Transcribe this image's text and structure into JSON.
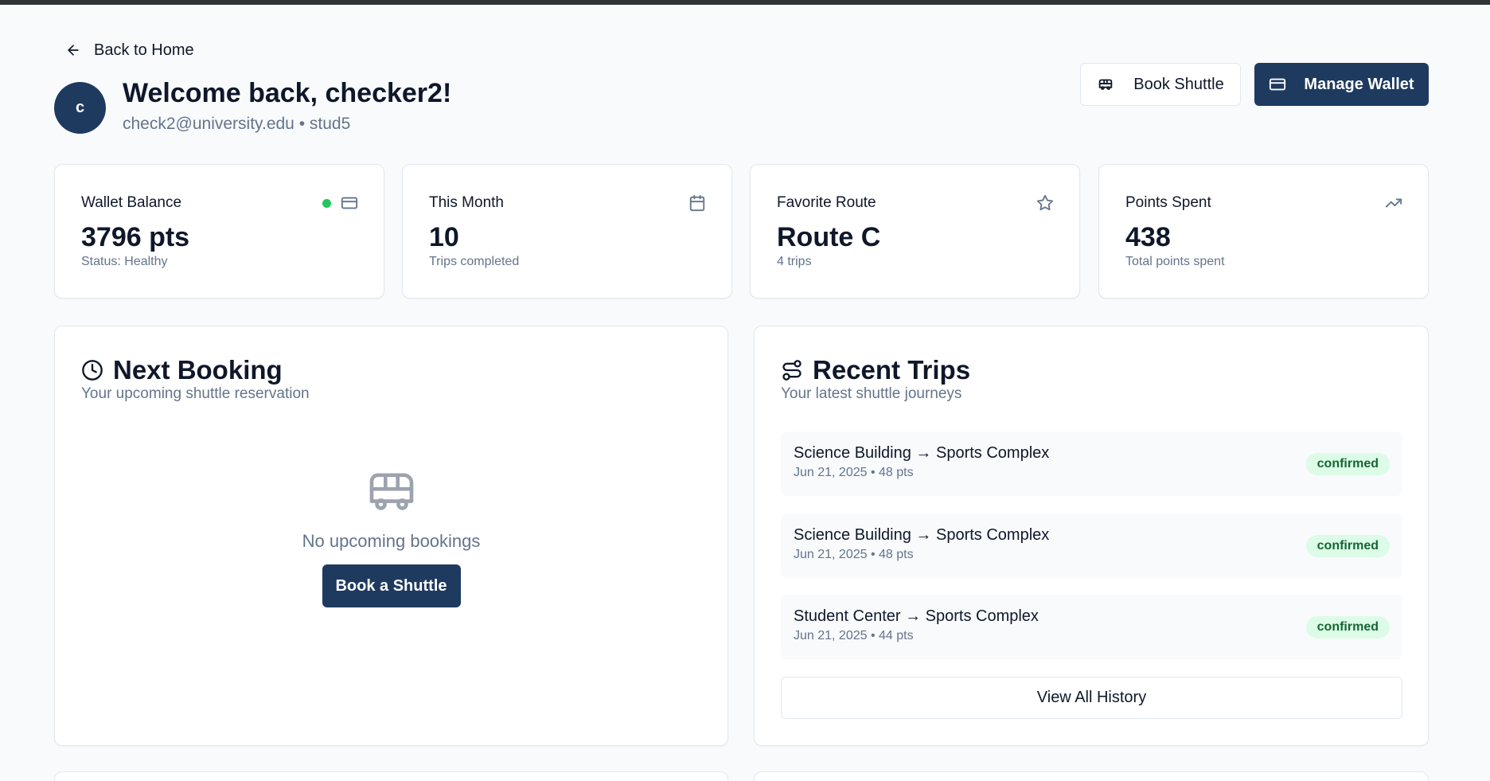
{
  "header": {
    "back_label": "Back to Home",
    "avatar_initial": "c",
    "welcome": "Welcome back, checker2!",
    "subtitle": "check2@university.edu • stud5",
    "book_shuttle_label": "Book Shuttle",
    "manage_wallet_label": "Manage Wallet"
  },
  "stats": [
    {
      "label": "Wallet Balance",
      "value": "3796 pts",
      "sub": "Status: Healthy",
      "icon": "credit-card-icon",
      "status_color": "#22c55e"
    },
    {
      "label": "This Month",
      "value": "10",
      "sub": "Trips completed",
      "icon": "calendar-icon"
    },
    {
      "label": "Favorite Route",
      "value": "Route C",
      "sub": "4 trips",
      "icon": "star-icon"
    },
    {
      "label": "Points Spent",
      "value": "438",
      "sub": "Total points spent",
      "icon": "trending-up-icon"
    }
  ],
  "next_booking": {
    "title": "Next Booking",
    "subtitle": "Your upcoming shuttle reservation",
    "empty_text": "No upcoming bookings",
    "button_label": "Book a Shuttle"
  },
  "recent_trips": {
    "title": "Recent Trips",
    "subtitle": "Your latest shuttle journeys",
    "trips": [
      {
        "route": "Science Building → Sports Complex",
        "meta": "Jun 21, 2025 • 48 pts",
        "status": "confirmed"
      },
      {
        "route": "Science Building → Sports Complex",
        "meta": "Jun 21, 2025 • 48 pts",
        "status": "confirmed"
      },
      {
        "route": "Student Center → Sports Complex",
        "meta": "Jun 21, 2025 • 44 pts",
        "status": "confirmed"
      }
    ],
    "view_all_label": "View All History"
  },
  "colors": {
    "primary": "#1e3a5f",
    "status_healthy": "#22c55e",
    "badge_bg": "#dcfce7",
    "badge_text": "#166534"
  }
}
